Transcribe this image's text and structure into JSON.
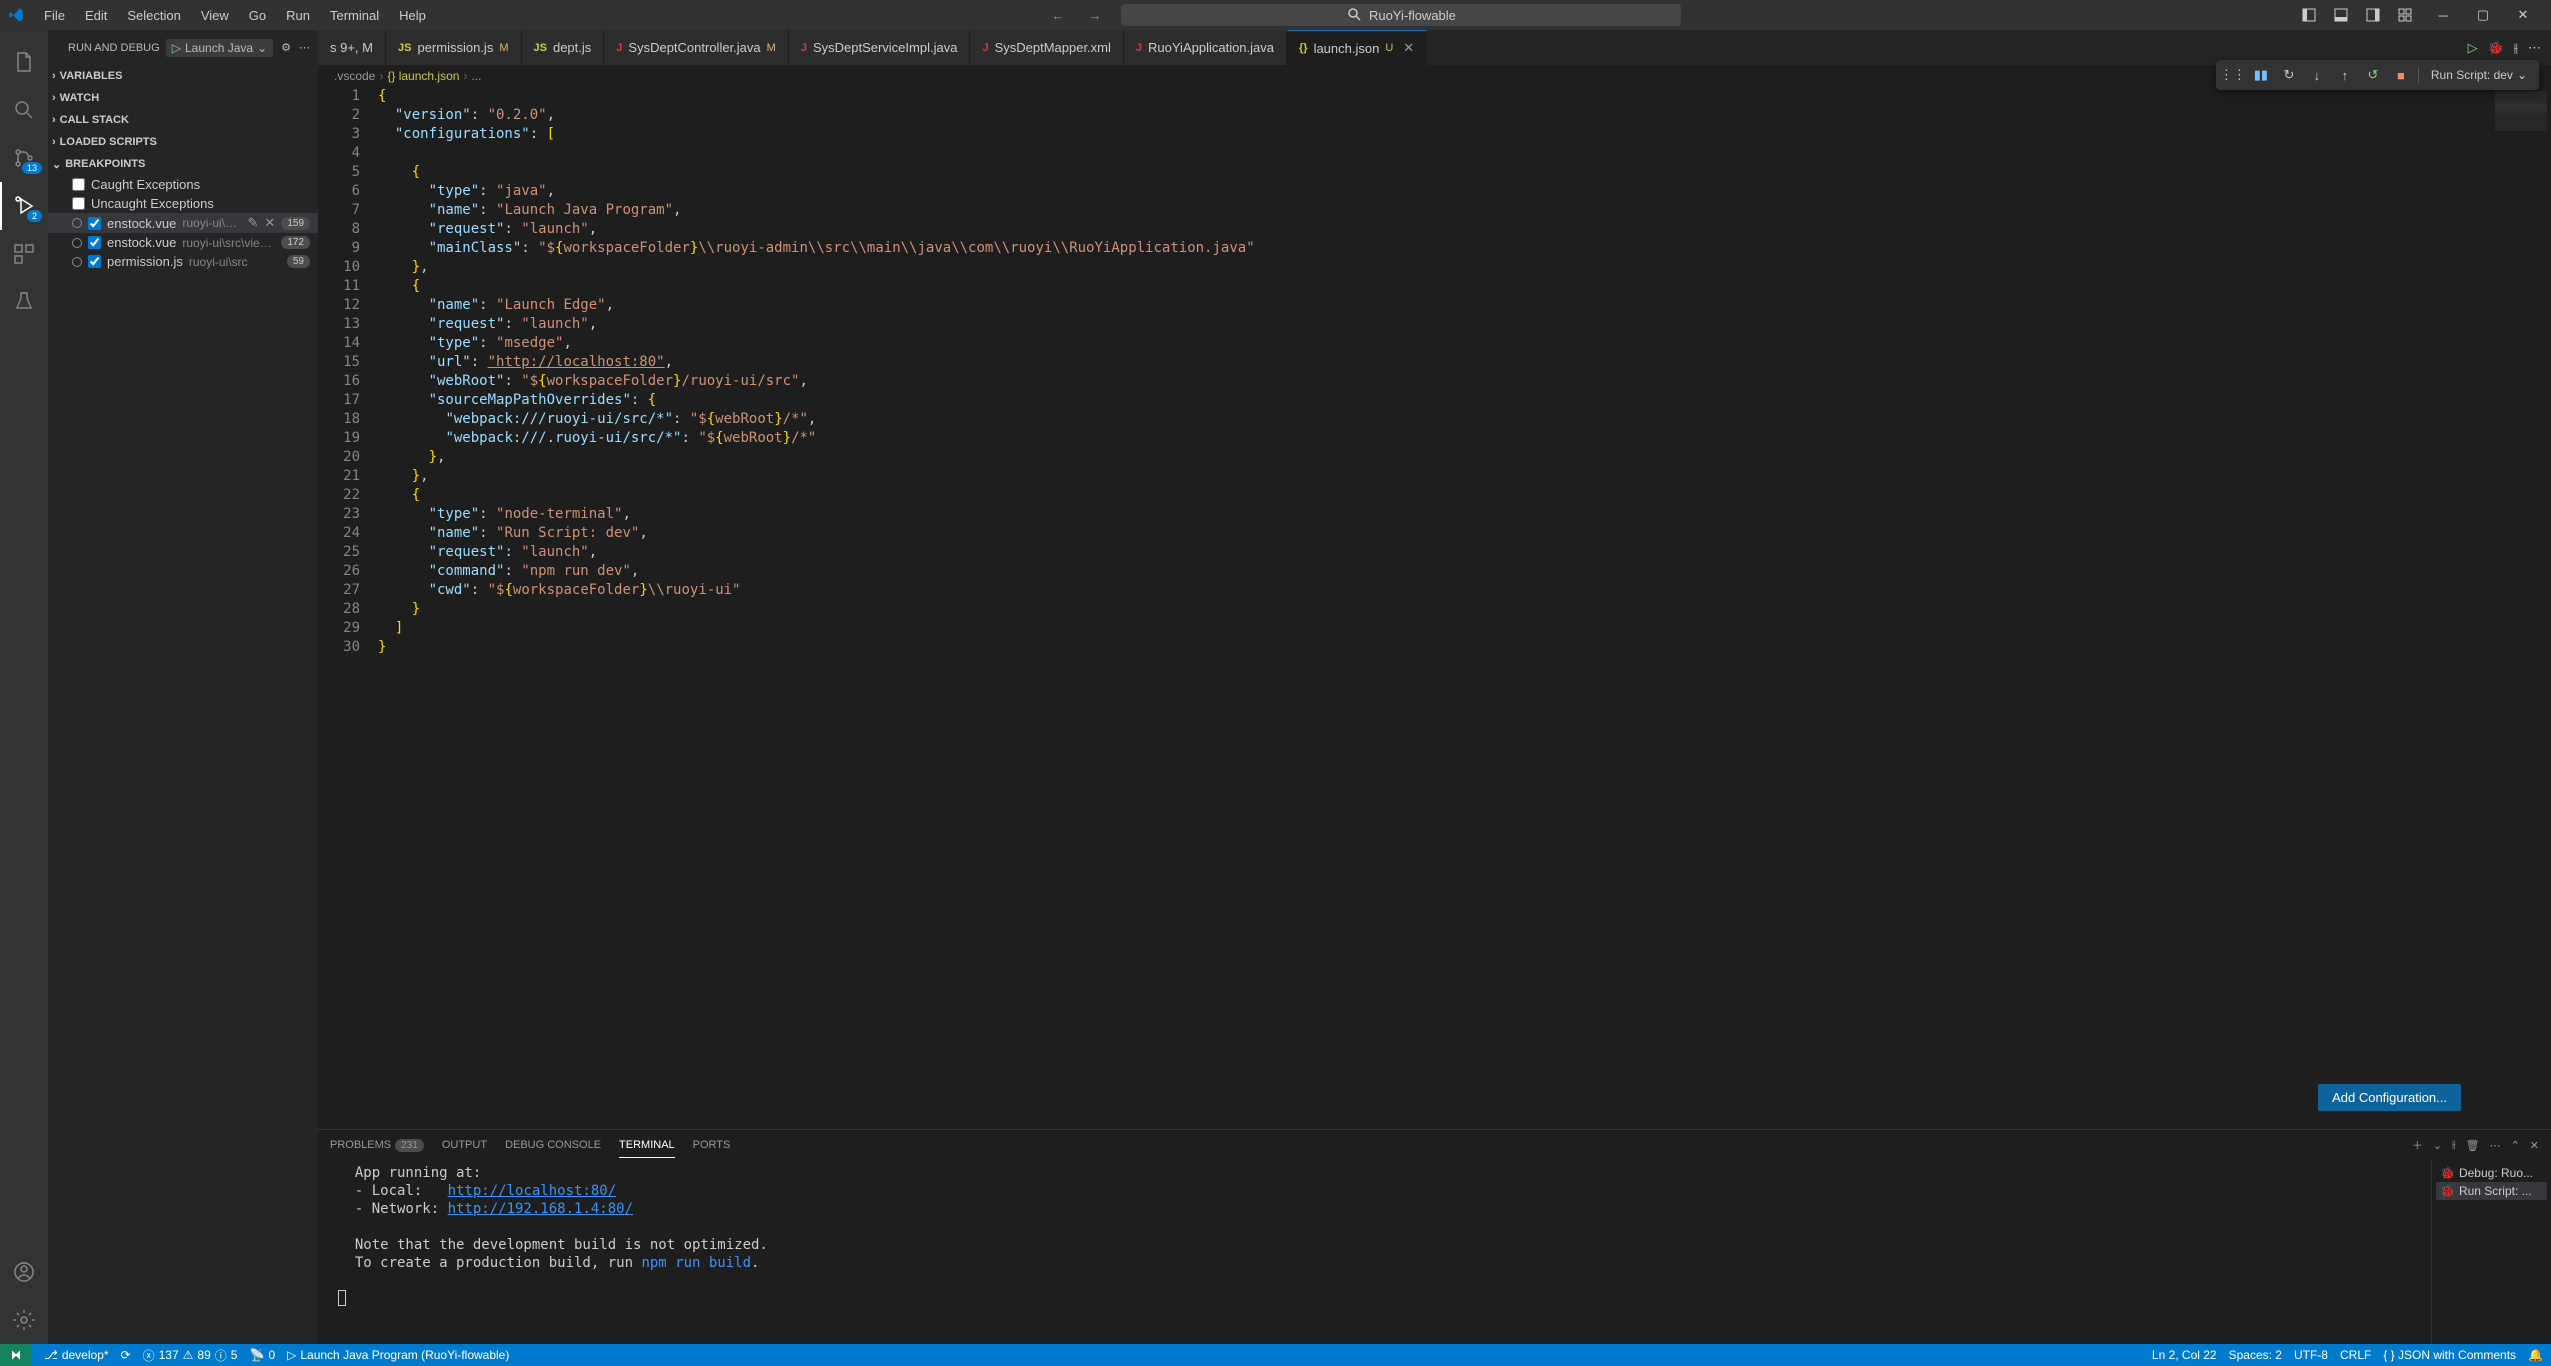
{
  "titlebar": {
    "menus": [
      "File",
      "Edit",
      "Selection",
      "View",
      "Go",
      "Run",
      "Terminal",
      "Help"
    ],
    "search_label": "RuoYi-flowable"
  },
  "activity": {
    "scm_badge": "13",
    "debug_badge": "2"
  },
  "sidebar": {
    "title": "RUN AND DEBUG",
    "launch_label": "Launch Java",
    "sections": {
      "variables": "VARIABLES",
      "watch": "WATCH",
      "callstack": "CALL STACK",
      "loadedscripts": "LOADED SCRIPTS",
      "breakpoints": "BREAKPOINTS"
    },
    "bp_caught": "Caught Exceptions",
    "bp_uncaught": "Uncaught Exceptions",
    "breakpoints": [
      {
        "file": "enstock.vue",
        "path": "ruoyi-ui\\src\\vi...",
        "count": "159",
        "selected": true,
        "edit": true
      },
      {
        "file": "enstock.vue",
        "path": "ruoyi-ui\\src\\views\\home",
        "count": "172"
      },
      {
        "file": "permission.js",
        "path": "ruoyi-ui\\src",
        "count": "59"
      }
    ]
  },
  "tabs": [
    {
      "icon": "js",
      "label": "s 9+, M",
      "mod": "",
      "partial": true
    },
    {
      "icon": "js",
      "iconText": "JS",
      "label": "permission.js",
      "mod": "M"
    },
    {
      "icon": "js",
      "iconText": "JS",
      "label": "dept.js"
    },
    {
      "icon": "java",
      "iconText": "J",
      "label": "SysDeptController.java",
      "mod": "M"
    },
    {
      "icon": "java",
      "iconText": "J",
      "label": "SysDeptServiceImpl.java"
    },
    {
      "icon": "java",
      "iconText": "J",
      "label": "SysDeptMapper.xml"
    },
    {
      "icon": "java",
      "iconText": "J",
      "label": "RuoYiApplication.java"
    },
    {
      "icon": "json",
      "iconText": "{}",
      "label": "launch.json",
      "mod": "U",
      "active": true,
      "close": true
    }
  ],
  "breadcrumb": {
    "parts": [
      ".vscode",
      "{} launch.json",
      "..."
    ]
  },
  "editor": {
    "lines": [
      "{",
      "  \"version\": \"0.2.0\",",
      "  \"configurations\": [",
      "",
      "    {",
      "      \"type\": \"java\",",
      "      \"name\": \"Launch Java Program\",",
      "      \"request\": \"launch\",",
      "      \"mainClass\": \"${workspaceFolder}\\\\ruoyi-admin\\\\src\\\\main\\\\java\\\\com\\\\ruoyi\\\\RuoYiApplication.java\"",
      "    },",
      "    {",
      "      \"name\": \"Launch Edge\",",
      "      \"request\": \"launch\",",
      "      \"type\": \"msedge\",",
      "      \"url\": \"http://localhost:80\",",
      "      \"webRoot\": \"${workspaceFolder}/ruoyi-ui/src\",",
      "      \"sourceMapPathOverrides\": {",
      "        \"webpack:///ruoyi-ui/src/*\": \"${webRoot}/*\",",
      "        \"webpack:///.ruoyi-ui/src/*\": \"${webRoot}/*\"",
      "      },",
      "    },",
      "    {",
      "      \"type\": \"node-terminal\",",
      "      \"name\": \"Run Script: dev\",",
      "      \"request\": \"launch\",",
      "      \"command\": \"npm run dev\",",
      "      \"cwd\": \"${workspaceFolder}\\\\ruoyi-ui\"",
      "    }",
      "  ]",
      "}"
    ],
    "add_config": "Add Configuration..."
  },
  "debug_toolbar": {
    "script": "Run Script: dev"
  },
  "panel": {
    "tabs": {
      "problems": "PROBLEMS",
      "problems_count": "231",
      "output": "OUTPUT",
      "debug": "DEBUG CONSOLE",
      "terminal": "TERMINAL",
      "ports": "PORTS"
    },
    "terminal_lines": [
      "  App running at:",
      "  - Local:   http://localhost:80/",
      "  - Network: http://192.168.1.4:80/",
      "",
      "  Note that the development build is not optimized.",
      "  To create a production build, run npm run build."
    ],
    "side": [
      {
        "label": "Debug: Ruo..."
      },
      {
        "label": "Run Script: ...",
        "active": true
      }
    ]
  },
  "statusbar": {
    "branch": "develop*",
    "sync": "",
    "errors": "137",
    "warnings": "89",
    "info": "5",
    "ports": "0",
    "debug_label": "Launch Java Program (RuoYi-flowable)",
    "pos": "Ln 2, Col 22",
    "spaces": "Spaces: 2",
    "encoding": "UTF-8",
    "eol": "CRLF",
    "lang": "{ } JSON with Comments",
    "feedback": ""
  }
}
